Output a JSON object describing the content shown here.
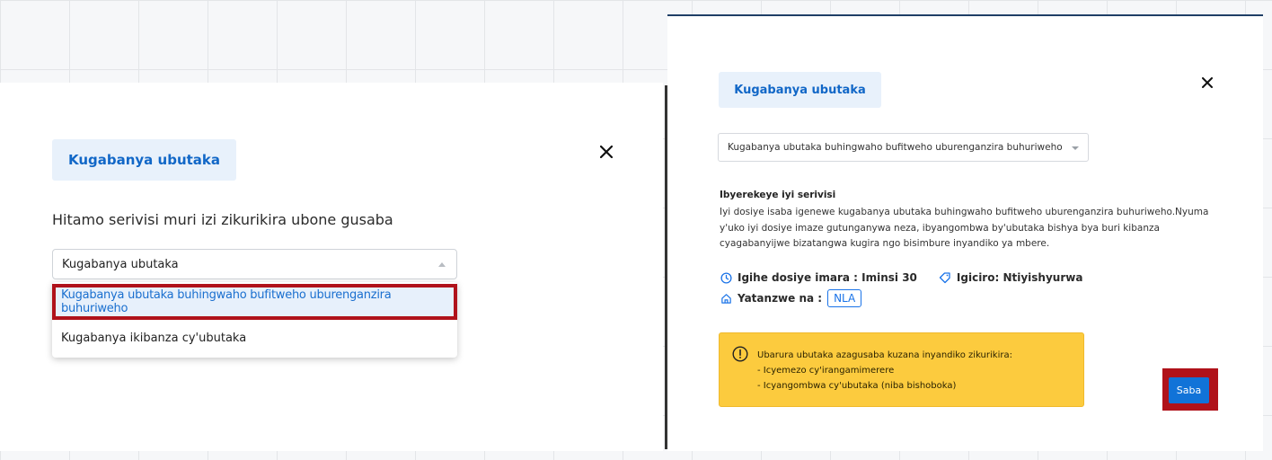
{
  "left_panel": {
    "service_tag": "Kugabanya ubutaka",
    "heading": "Hitamo serivisi muri izi zikurikira ubone gusaba",
    "select_value": "Kugabanya ubutaka",
    "options": [
      "Kugabanya ubutaka buhingwaho bufitweho uburenganzira buhuriweho",
      "Kugabanya ikibanza cy'ubutaka"
    ],
    "selected_option_index": 0
  },
  "right_panel": {
    "service_tag": "Kugabanya ubutaka",
    "select_value": "Kugabanya ubutaka buhingwaho bufitweho uburenganzira buhuriweho",
    "info_title": "Ibyerekeye iyi serivisi",
    "info_text": "Iyi dosiye isaba igenewe kugabanya ubutaka buhingwaho bufitweho uburenganzira buhuriweho.Nyuma y'uko iyi dosiye imaze gutunganywa neza, ibyangombwa by'ubutaka bishya bya buri kibanza cyagabanyijwe bizatangwa kugira ngo bisimbure inyandiko ya mbere.",
    "duration_label": "Igihe dosiye imara : Iminsi 30",
    "price_label": "Igiciro: Ntiyishyurwa",
    "provider_label": "Yatanzwe na :",
    "provider_badge": "NLA",
    "notice_lines": [
      "Ubarura ubutaka azagusaba kuzana inyandiko zikurikira:",
      "- Icyemezo cy'irangamimerere",
      "- Icyangombwa cy'ubutaka (niba bishoboka)"
    ],
    "send_label": "Saba"
  },
  "icons": {
    "close": "close-icon",
    "clock": "clock-icon",
    "tag": "tag-icon",
    "home": "home-icon",
    "alert": "alert-circle-icon"
  },
  "colors": {
    "accent": "#1167c7",
    "tag_background": "#e8f1fb",
    "highlight_border": "#b0121a",
    "notice_background": "#fccb3e",
    "send_button": "#1173d8"
  }
}
